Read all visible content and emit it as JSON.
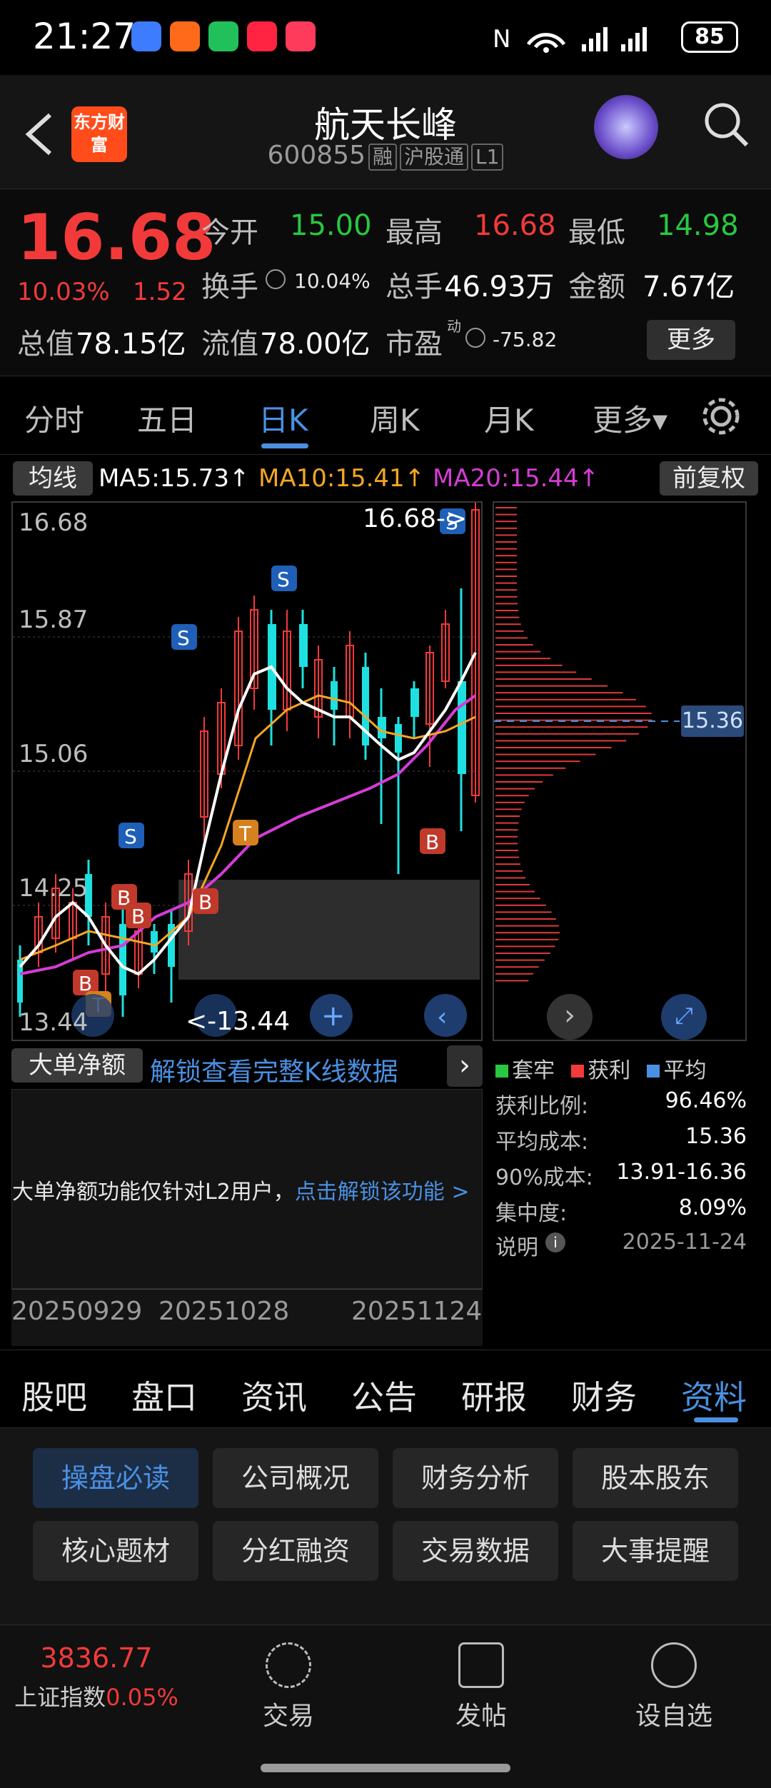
{
  "status_bar": {
    "time": "21:27",
    "battery": "85"
  },
  "header": {
    "logo_text": "东方财富",
    "title": "航天长峰",
    "code": "600855",
    "tags": [
      "融",
      "沪股通",
      "L1"
    ]
  },
  "quote": {
    "price": "16.68",
    "change_pct": "10.03%",
    "change_amt": "1.52",
    "open_label": "今开",
    "open": "15.00",
    "high_label": "最高",
    "high": "16.68",
    "low_label": "最低",
    "low": "14.98",
    "turnover_label": "换手",
    "turnover": "10.04%",
    "volume_label": "总手",
    "volume": "46.93万",
    "amount_label": "金额",
    "amount": "7.67亿",
    "mktcap_label": "总值",
    "mktcap": "78.15亿",
    "float_label": "流值",
    "float_cap": "78.00亿",
    "pe_label": "市盈",
    "pe_sup": "动",
    "pe": "-75.82",
    "more_label": "更多"
  },
  "tabs": [
    "分时",
    "五日",
    "日K",
    "周K",
    "月K",
    "更多▾"
  ],
  "ma_bar": {
    "toggle": "均线",
    "ma5": "MA5:15.73↑",
    "ma10": "MA10:15.41↑",
    "ma20": "MA20:15.44↑",
    "adjust": "前复权"
  },
  "chart": {
    "y_labels": [
      "16.68",
      "15.87",
      "15.06",
      "14.25",
      "13.44"
    ],
    "high_marker": "16.68->",
    "low_marker": "<-13.44",
    "avg_cost_label": "15.36"
  },
  "net_bar": {
    "label": "大单净额",
    "unlock": "解锁查看完整K线数据"
  },
  "net_panel": {
    "notice": "大单净额功能仅针对L2用户，",
    "unlock_link": "点击解锁该功能 >"
  },
  "date_axis": [
    "20250929",
    "20251028",
    "20251124"
  ],
  "legend": [
    "套牢",
    "获利",
    "平均"
  ],
  "stats": [
    {
      "label": "获利比例:",
      "value": "96.46%"
    },
    {
      "label": "平均成本:",
      "value": "15.36"
    },
    {
      "label": "90%成本:",
      "value": "13.91-16.36"
    },
    {
      "label": "集中度:",
      "value": "8.09%"
    },
    {
      "label": "说明",
      "value": "2025-11-24"
    }
  ],
  "section_tabs": [
    "股吧",
    "盘口",
    "资讯",
    "公告",
    "研报",
    "财务",
    "资料"
  ],
  "grid_buttons": [
    "操盘必读",
    "公司概况",
    "财务分析",
    "股本股东",
    "核心题材",
    "分红融资",
    "交易数据",
    "大事提醒"
  ],
  "bottom": {
    "index_value": "3836.77",
    "index_name": "上证指数",
    "index_change": "0.05%",
    "trade": "交易",
    "post": "发帖",
    "watch": "设自选"
  }
}
